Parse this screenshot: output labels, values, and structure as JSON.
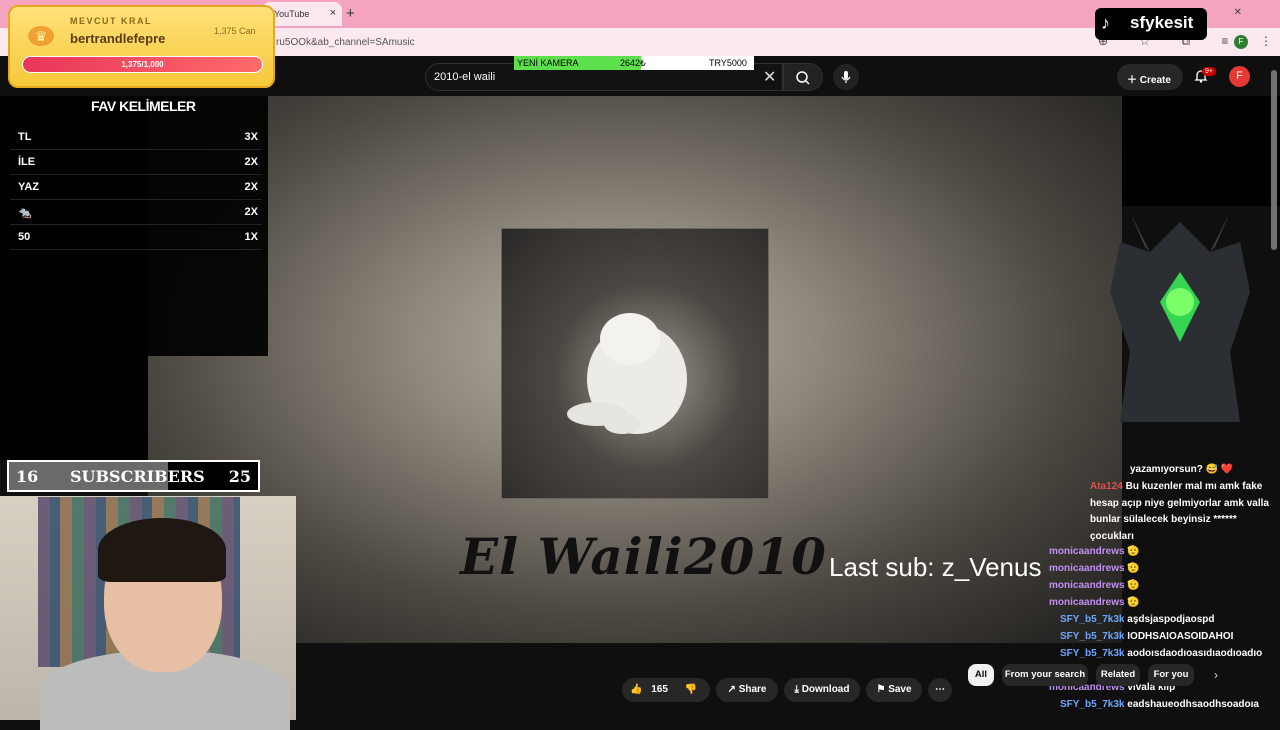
{
  "browser": {
    "tab_title": "YouTube",
    "tab_close": "×",
    "new_tab": "+",
    "url_partial": "ru5OOk&ab_channel=SAmusic",
    "profile_initial": "F",
    "menu": "⋮"
  },
  "youtube": {
    "search_value": "2010-el waili",
    "create_label": "Create",
    "notif_count": "9+",
    "profile_initial": "F",
    "video_title_overlay": "El Waili2010",
    "actions": {
      "like_count": "165",
      "share": "Share",
      "download": "Download",
      "save": "Save"
    },
    "chips": [
      "All",
      "From your search",
      "Related",
      "For you"
    ]
  },
  "overlays": {
    "goal": {
      "label": "YENİ KAMERA",
      "amount": "2642₺",
      "target": "TRY5000",
      "fill_fraction": 0.528
    },
    "king": {
      "label": "MEVCUT KRAL",
      "name": "bertrandlefepre",
      "coins": "1,375 Can",
      "progress": "1,375/1,000"
    },
    "fav_title": "FAV KELİMELER",
    "fav_words": [
      {
        "word": "TL",
        "count": "3X"
      },
      {
        "word": "İLE",
        "count": "2X"
      },
      {
        "word": "YAZ",
        "count": "2X"
      },
      {
        "word": "🐀",
        "count": "2X"
      },
      {
        "word": "50",
        "count": "1X"
      }
    ],
    "subscribers": {
      "current": "16",
      "label": "SUBSCRIBERS",
      "goal": "25",
      "fill_fraction": 0.64
    },
    "last_sub": "Last sub: z_Venus",
    "tiktok_name": "sfykesit"
  },
  "chat": [
    {
      "name": "",
      "text": "yazamıyorsun? 😅 ❤️",
      "color": "nm-red"
    },
    {
      "name": "Ata124",
      "text": "Bu kuzenler mal mı amk fake hesap açıp niye gelmiyorlar amk valla bunlar sülalecek beyinsiz ****** çocukları",
      "color": "nm-red"
    },
    {
      "name": "monicaandrews",
      "text": "🫡",
      "color": "nm-pur"
    },
    {
      "name": "monicaandrews",
      "text": "🫡",
      "color": "nm-pur"
    },
    {
      "name": "monicaandrews",
      "text": "🫡",
      "color": "nm-pur"
    },
    {
      "name": "monicaandrews",
      "text": "🫡",
      "color": "nm-pur"
    },
    {
      "name": "SFY_b5_7k3k",
      "text": "aşdsjaspodjaospd",
      "color": "nm-blu"
    },
    {
      "name": "SFY_b5_7k3k",
      "text": "IODHSAIOASOIDAHOI",
      "color": "nm-blu"
    },
    {
      "name": "SFY_b5_7k3k",
      "text": "aodoısdaodıoasıdıaodıoadıo",
      "color": "nm-blu"
    },
    {
      "name": "monicaandrews",
      "text": "vivala klip",
      "color": "nm-pur"
    },
    {
      "name": "SFY_b5_7k3k",
      "text": "eadshaueodhsaodhsoadoıa",
      "color": "nm-blu"
    }
  ]
}
